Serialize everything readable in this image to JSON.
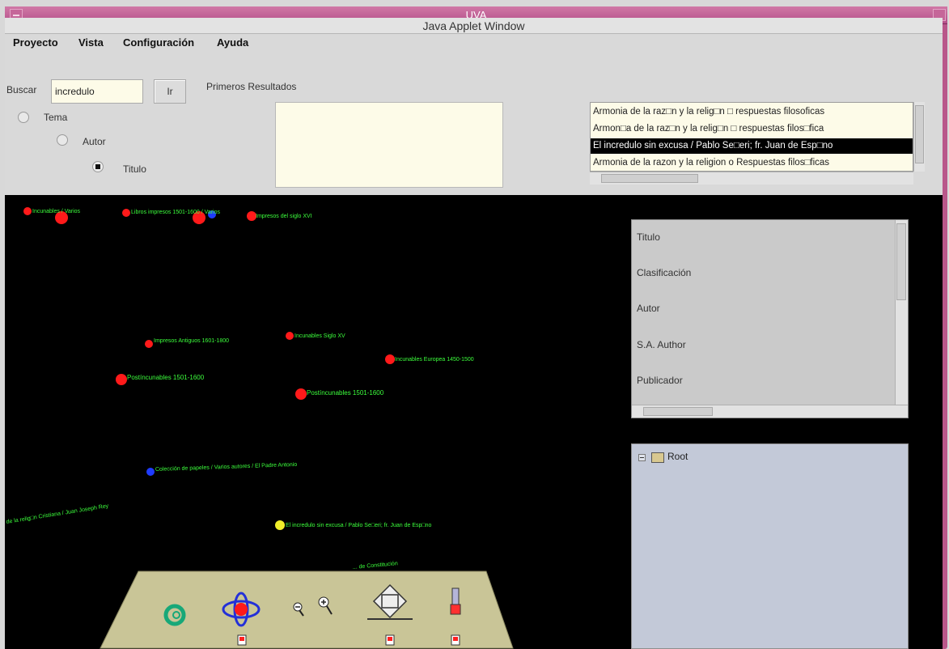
{
  "window": {
    "title": "UVA",
    "subtitle": "Java Applet Window"
  },
  "menu": [
    "Proyecto",
    "Vista",
    "Configuración",
    "Ayuda"
  ],
  "search": {
    "label": "Buscar",
    "value": "incredulo",
    "button": "Ir"
  },
  "results": {
    "label": "Primeros Resultados"
  },
  "radios": [
    {
      "label": "Tema",
      "selected": false
    },
    {
      "label": "Autor",
      "selected": false
    },
    {
      "label": "Titulo",
      "selected": true
    }
  ],
  "list": {
    "items": [
      "Armonia de la raz□n y la relig□n □ respuestas filosoficas",
      "Armon□a de la raz□n y la relig□n □ respuestas filos□fica",
      "El incredulo sin excusa / Pablo Se□eri; fr. Juan de Esp□no",
      "Armonia de la razon y la religion o Respuestas filos□ficas"
    ],
    "selected_index": 2
  },
  "scene": {
    "node_labels": [
      "Incunables / Varios",
      "Libros impresos 1501-1600 / Varios",
      "Impresos del siglo XVI",
      "Impresos Antiguos 1601-1800",
      "Incunables Siglo XV",
      "Incunables Europea 1450-1500",
      "Postíncunables 1501-1600",
      "Postíncunables 1501-1600",
      "Colección de papeles / Varios autores / El Padre Antonio",
      "de la relig□n Cristiana / Juan Joseph Rey",
      "El incredulo sin excusa / Pablo Se□eri; fr. Juan de Esp□no",
      "... de Constitución"
    ],
    "colors": {
      "node_red": "#ff1a1a",
      "node_blue": "#1f3cff",
      "node_yellow": "#f0ef2a",
      "label_green": "#3cff3c"
    }
  },
  "properties": [
    "Titulo",
    "Clasificación",
    "Autor",
    "S.A. Author",
    "Publicador"
  ],
  "tree": {
    "root": "Root"
  },
  "toolbar_icons": [
    "rotate-icon",
    "orbit-icon",
    "zoom-icon",
    "perspective-icon",
    "height-icon"
  ]
}
